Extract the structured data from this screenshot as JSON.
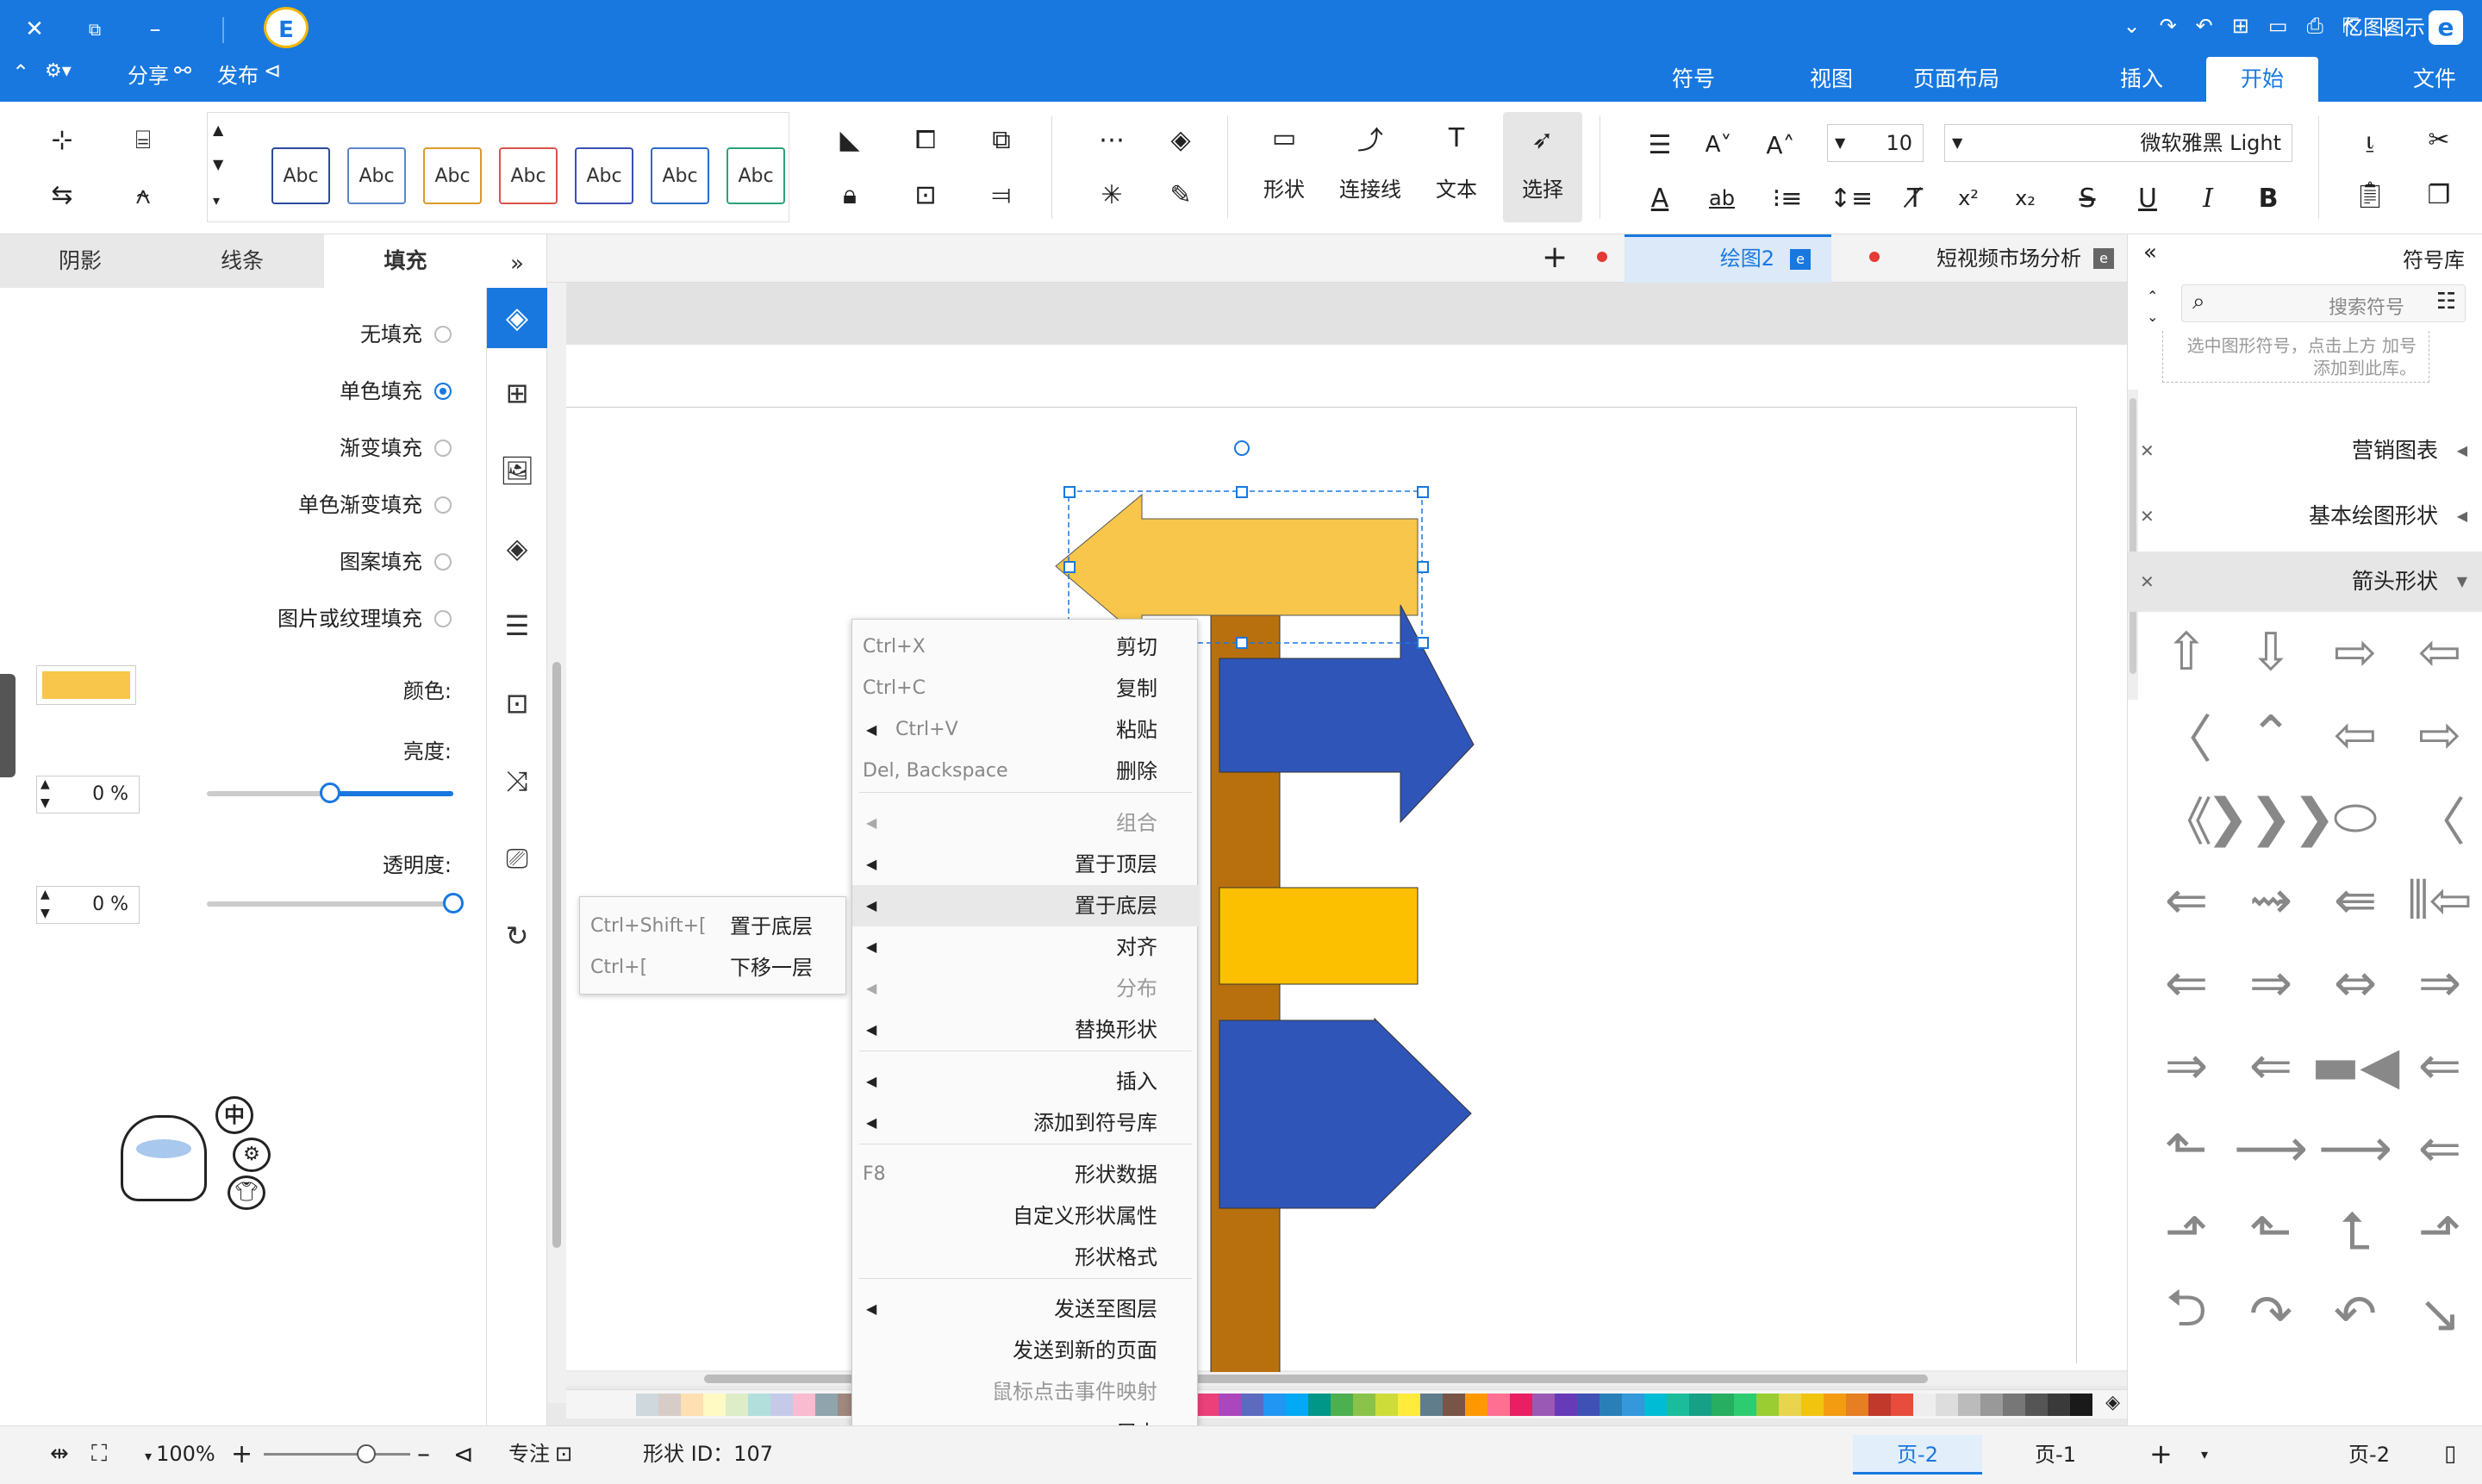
{
  "title_bar": {
    "app_name": "亿图图示",
    "actions": {
      "publish": "发布",
      "share": "分享"
    },
    "menu_tabs": [
      {
        "label": "文件",
        "active": false
      },
      {
        "label": "开始",
        "active": true
      },
      {
        "label": "插入",
        "active": false
      },
      {
        "label": "页面布局",
        "active": false
      },
      {
        "label": "视图",
        "active": false
      },
      {
        "label": "符号",
        "active": false
      }
    ]
  },
  "ribbon": {
    "font_name": "微软雅黑 Light",
    "font_size": "10",
    "tools": {
      "select": "选择",
      "text": "文本",
      "connector": "连接线",
      "shape": "形状"
    },
    "style_swatch_text": "Abc",
    "style_colors": [
      "#2aa37a",
      "#2b6cc9",
      "#3a4fb5",
      "#d9534f",
      "#d99a2b",
      "#5a86c9",
      "#2b4a9a"
    ]
  },
  "left_panel": {
    "tabs": {
      "fill": "填充",
      "line": "线条",
      "shadow": "阴影"
    },
    "fill_options": [
      {
        "label": "无填充",
        "selected": false
      },
      {
        "label": "单色填充",
        "selected": true
      },
      {
        "label": "渐变填充",
        "selected": false
      },
      {
        "label": "单色渐变填充",
        "selected": false
      },
      {
        "label": "图案填充",
        "selected": false
      },
      {
        "label": "图片或纹理填充",
        "selected": false
      }
    ],
    "color_label": "颜色:",
    "fill_color": "#f7c64a",
    "brightness_label": "亮度:",
    "brightness_value": "0 %",
    "brightness_level": 0.5,
    "transparency_label": "透明度:",
    "transparency_value": "0 %",
    "transparency_level": 0.0,
    "ime_label": "中"
  },
  "document_tabs": [
    {
      "label": "短视频市场分析",
      "active": false
    },
    {
      "label": "绘图2",
      "active": true
    }
  ],
  "library": {
    "title": "符号库",
    "search_placeholder": "搜索符号",
    "hint_text": "选中图形符号，点击上方 加号添加到此库。",
    "categories": [
      {
        "label": "营销图表",
        "expanded": false
      },
      {
        "label": "基本绘图形状",
        "expanded": false
      },
      {
        "label": "箭头形状",
        "expanded": true
      }
    ]
  },
  "diagram": {
    "colors": {
      "post": "#b8700f",
      "sign_top": "#f7c64a",
      "sign_blue": "#2f55b8",
      "sign_gold": "#fdc000"
    }
  },
  "context_menu": {
    "items": [
      {
        "label": "剪切",
        "shortcut": "Ctrl+X",
        "arrow": false,
        "disabled": false
      },
      {
        "label": "复制",
        "shortcut": "Ctrl+C",
        "arrow": false,
        "disabled": false
      },
      {
        "label": "粘贴",
        "shortcut": "Ctrl+V",
        "arrow": true,
        "disabled": false
      },
      {
        "label": "删除",
        "shortcut": "Del, Backspace",
        "arrow": false,
        "disabled": false
      },
      {
        "label": "组合",
        "shortcut": "",
        "arrow": true,
        "disabled": true
      },
      {
        "label": "置于顶层",
        "shortcut": "",
        "arrow": true,
        "disabled": false
      },
      {
        "label": "置于底层",
        "shortcut": "",
        "arrow": true,
        "disabled": false,
        "highlighted": true
      },
      {
        "label": "对齐",
        "shortcut": "",
        "arrow": true,
        "disabled": false
      },
      {
        "label": "分布",
        "shortcut": "",
        "arrow": true,
        "disabled": true
      },
      {
        "label": "替换形状",
        "shortcut": "",
        "arrow": true,
        "disabled": false
      },
      {
        "label": "插入",
        "shortcut": "",
        "arrow": true,
        "disabled": false
      },
      {
        "label": "添加到符号库",
        "shortcut": "",
        "arrow": true,
        "disabled": false
      },
      {
        "label": "形状数据",
        "shortcut": "F8",
        "arrow": false,
        "disabled": false
      },
      {
        "label": "自定义形状属性",
        "shortcut": "",
        "arrow": false,
        "disabled": false
      },
      {
        "label": "形状格式",
        "shortcut": "",
        "arrow": false,
        "disabled": false
      },
      {
        "label": "发送至图层",
        "shortcut": "",
        "arrow": true,
        "disabled": false
      },
      {
        "label": "发送到新的页面",
        "shortcut": "",
        "arrow": false,
        "disabled": false
      },
      {
        "label": "鼠标点击事件映射",
        "shortcut": "",
        "arrow": false,
        "disabled": true
      },
      {
        "label": "居中",
        "shortcut": "",
        "arrow": false,
        "disabled": false
      }
    ],
    "submenu": [
      {
        "label": "置于底层",
        "shortcut": "Ctrl+Shift+["
      },
      {
        "label": "下移一层",
        "shortcut": "Ctrl+["
      }
    ]
  },
  "status_bar": {
    "pages": [
      "页-2",
      "页-1",
      "页-2"
    ],
    "shape_id": "形状 ID：107",
    "focus": "专注",
    "zoom": "100%"
  },
  "palette": [
    "#1a1a1a",
    "#3a3a3a",
    "#555",
    "#777",
    "#999",
    "#bbb",
    "#ddd",
    "#eee",
    "#e74c3c",
    "#c0392b",
    "#e67e22",
    "#f39c12",
    "#f1c40f",
    "#e8d44d",
    "#9acd32",
    "#2ecc71",
    "#27ae60",
    "#16a085",
    "#1abc9c",
    "#00bcd4",
    "#3498db",
    "#2980b9",
    "#3f51b5",
    "#673ab7",
    "#9b59b6",
    "#e91e63",
    "#ff6f91",
    "#ff9800",
    "#795548",
    "#607d8b",
    "#ffeb3b",
    "#cddc39",
    "#8bc34a",
    "#4caf50",
    "#009688",
    "#03a9f4",
    "#2196f3",
    "#5c6bc0",
    "#ab47bc",
    "#ec407a",
    "#ef5350",
    "#ff7043",
    "#ffa726",
    "#ffca28",
    "#d4e157",
    "#9ccc65",
    "#66bb6a",
    "#26a69a",
    "#26c6da",
    "#29b6f6",
    "#42a5f5",
    "#7e57c2",
    "#ba68c8",
    "#f06292",
    "#e57373",
    "#a1887f",
    "#90a4ae",
    "#f8bbd0",
    "#c5cae9",
    "#b2dfdb",
    "#dcedc8",
    "#fff9c4",
    "#ffe0b2",
    "#d7ccc8",
    "#cfd8dc"
  ]
}
